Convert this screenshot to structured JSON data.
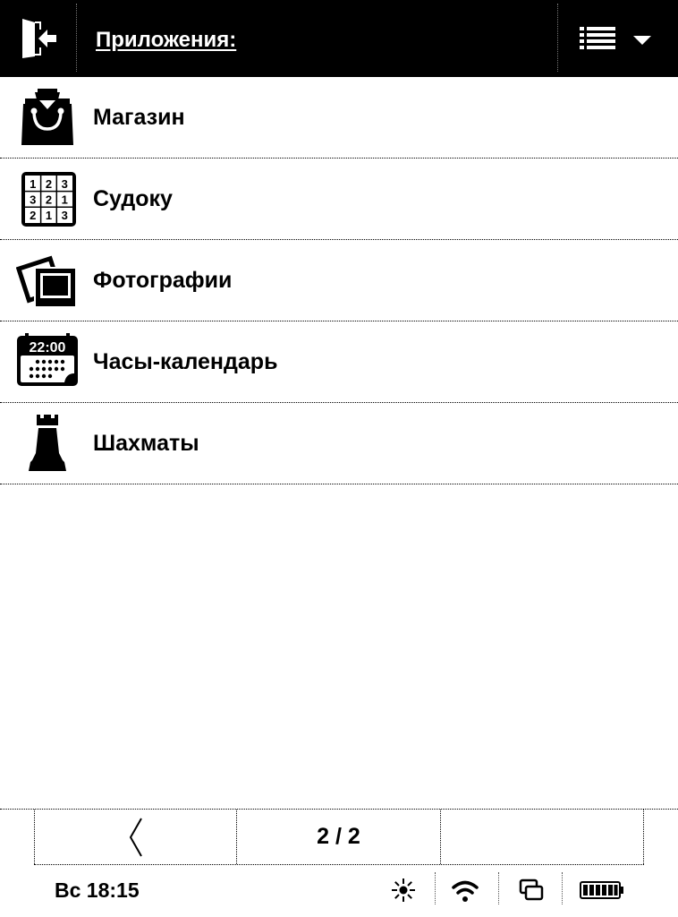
{
  "header": {
    "title": "Приложения:",
    "exit_icon": "exit-door-icon",
    "view_icon": "list-view-icon",
    "dropdown_icon": "triangle-down-icon"
  },
  "apps": [
    {
      "label": "Магазин",
      "icon": "shopping-bag-icon"
    },
    {
      "label": "Судоку",
      "icon": "sudoku-grid-icon",
      "grid": [
        "1",
        "2",
        "3",
        "3",
        "2",
        "1",
        "2",
        "1",
        "3"
      ]
    },
    {
      "label": "Фотографии",
      "icon": "photos-icon"
    },
    {
      "label": "Часы-календарь",
      "icon": "clock-calendar-icon",
      "time": "22:00"
    },
    {
      "label": "Шахматы",
      "icon": "chess-rook-icon"
    }
  ],
  "pager": {
    "prev_icon": "chevron-left-icon",
    "page": "2 / 2"
  },
  "status": {
    "clock": "Вс 18:15",
    "icons": [
      "brightness-icon",
      "wifi-icon",
      "windows-icon",
      "battery-icon"
    ]
  }
}
